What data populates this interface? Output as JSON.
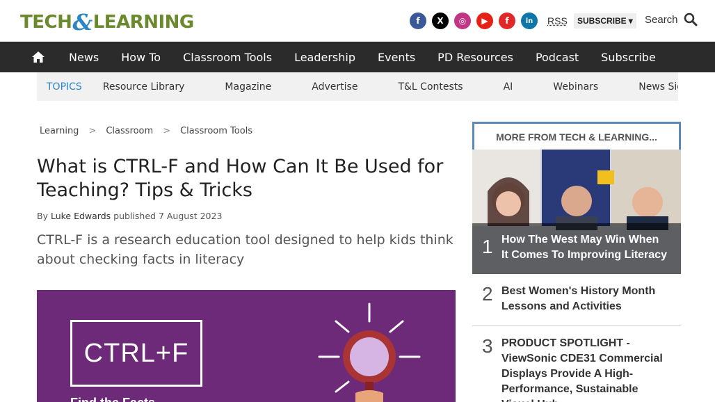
{
  "header": {
    "logo": {
      "part1": "TECH",
      "amp": "&",
      "part2": "LEARNING"
    },
    "socials": [
      {
        "name": "facebook-icon",
        "glyph": "f",
        "color": "#3b5998"
      },
      {
        "name": "x-icon",
        "glyph": "X",
        "color": "#000000"
      },
      {
        "name": "instagram-icon",
        "glyph": "◎",
        "color": "#c13584"
      },
      {
        "name": "youtube-icon",
        "glyph": "▶",
        "color": "#e62117"
      },
      {
        "name": "flipboard-icon",
        "glyph": "f",
        "color": "#e12828"
      },
      {
        "name": "linkedin-icon",
        "glyph": "in",
        "color": "#0e76a8"
      }
    ],
    "rss": "RSS",
    "subscribe": "SUBSCRIBE",
    "search": "Search"
  },
  "nav": {
    "items": [
      "News",
      "How To",
      "Classroom Tools",
      "Leadership",
      "Events",
      "PD Resources",
      "Podcast",
      "Subscribe"
    ]
  },
  "topics": {
    "label": "TOPICS",
    "items": [
      "Resource Library",
      "Magazine",
      "Advertise",
      "T&L Contests",
      "AI",
      "Webinars",
      "News Sig"
    ]
  },
  "breadcrumb": [
    "Learning",
    "Classroom",
    "Classroom Tools"
  ],
  "article": {
    "title": "What is CTRL-F and How Can It Be Used for Teaching? Tips & Tricks",
    "by": "By",
    "author": "Luke Edwards",
    "published": "published 7 August 2023",
    "standfirst": "CTRL-F is a research education tool designed to help kids think about checking facts in literacy",
    "hero_logo": "CTRL+F",
    "hero_caption": "Find the Facts"
  },
  "sidebar": {
    "heading": "MORE FROM TECH & LEARNING...",
    "stories": [
      {
        "rank": "1",
        "title": "How The West May Win When It Comes To Improving Literacy"
      },
      {
        "rank": "2",
        "title": "Best Women's History Month Lessons and Activities"
      },
      {
        "rank": "3",
        "title": "PRODUCT SPOTLIGHT - ViewSonic CDE31 Commercial Displays Provide A High-Performance, Sustainable Visual Hub"
      }
    ]
  }
}
